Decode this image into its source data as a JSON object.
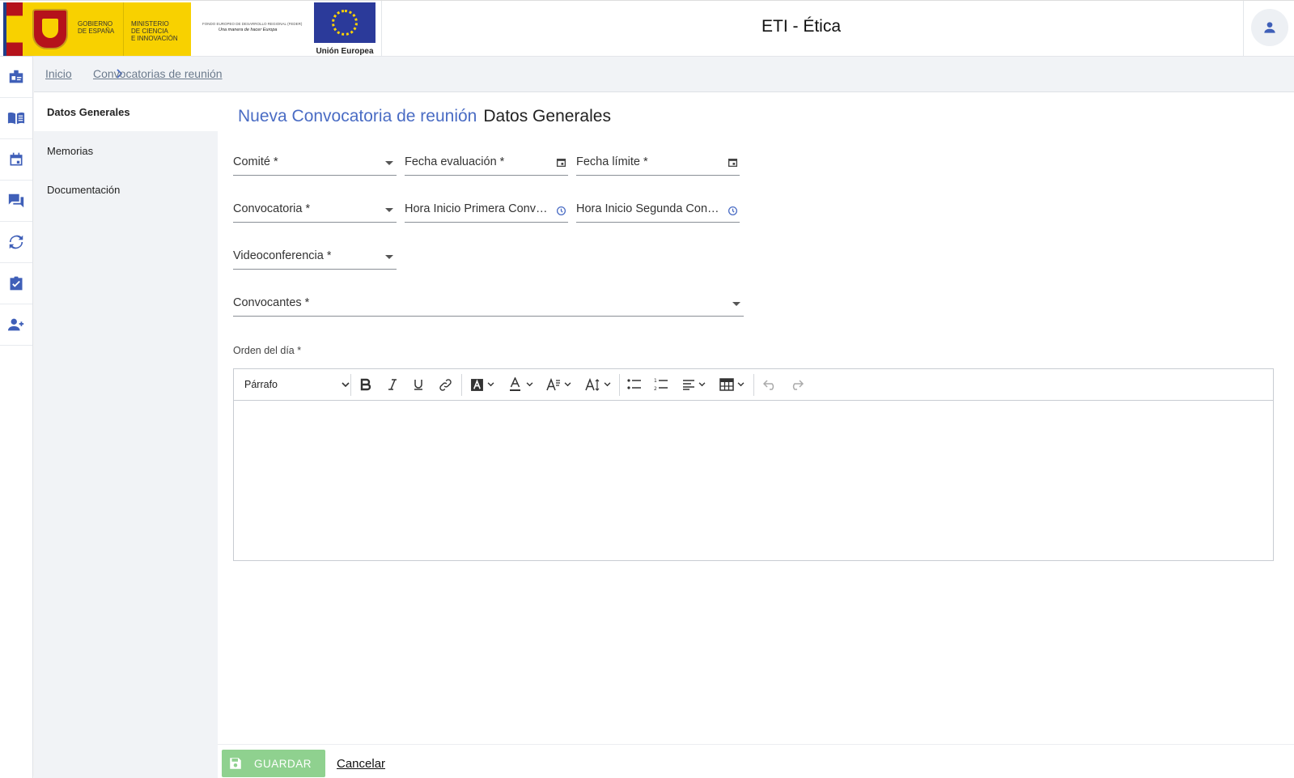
{
  "header": {
    "gobierno_text": "GOBIERNO\nDE ESPAÑA",
    "ministerio_text": "MINISTERIO\nDE CIENCIA\nE INNOVACIÓN",
    "feder_line1": "FONDO EUROPEO DE DESARROLLO REGIONAL (FEDER)",
    "feder_line2": "Una manera de hacer Europa",
    "eu_caption": "Unión Europea",
    "app_title": "ETI - Ética",
    "user_icon": "person-icon"
  },
  "rail": {
    "items": [
      {
        "icon": "badge-icon"
      },
      {
        "icon": "book-icon"
      },
      {
        "icon": "calendar-icon"
      },
      {
        "icon": "forum-icon"
      },
      {
        "icon": "sync-icon"
      },
      {
        "icon": "assignment-check-icon"
      },
      {
        "icon": "person-add-icon"
      }
    ]
  },
  "breadcrumb": {
    "home": "Inicio",
    "current": "Convocatorias de reunión"
  },
  "sidemenu": {
    "items": [
      {
        "label": "Datos Generales",
        "active": true
      },
      {
        "label": "Memorias",
        "active": false
      },
      {
        "label": "Documentación",
        "active": false
      }
    ]
  },
  "main": {
    "title": "Nueva Convocatoria de reunión",
    "subtitle": "Datos Generales",
    "fields": {
      "comite": "Comité *",
      "fecha_evaluacion": "Fecha evaluación *",
      "fecha_limite": "Fecha límite *",
      "convocatoria": "Convocatoria *",
      "hora_primera": "Hora Inicio Primera Convocatoria *",
      "hora_segunda": "Hora Inicio Segunda Convocatoria *",
      "videoconferencia": "Videoconferencia *",
      "convocantes": "Convocantes *"
    },
    "orden_label": "Orden del día *",
    "editor": {
      "paragraph_select": "Párrafo",
      "content": ""
    }
  },
  "footer": {
    "save_label": "GUARDAR",
    "cancel_label": "Cancelar"
  },
  "colors": {
    "accent": "#4a6cc4",
    "icon_blue": "#3f5fb8",
    "save_green": "#8fd18f"
  }
}
